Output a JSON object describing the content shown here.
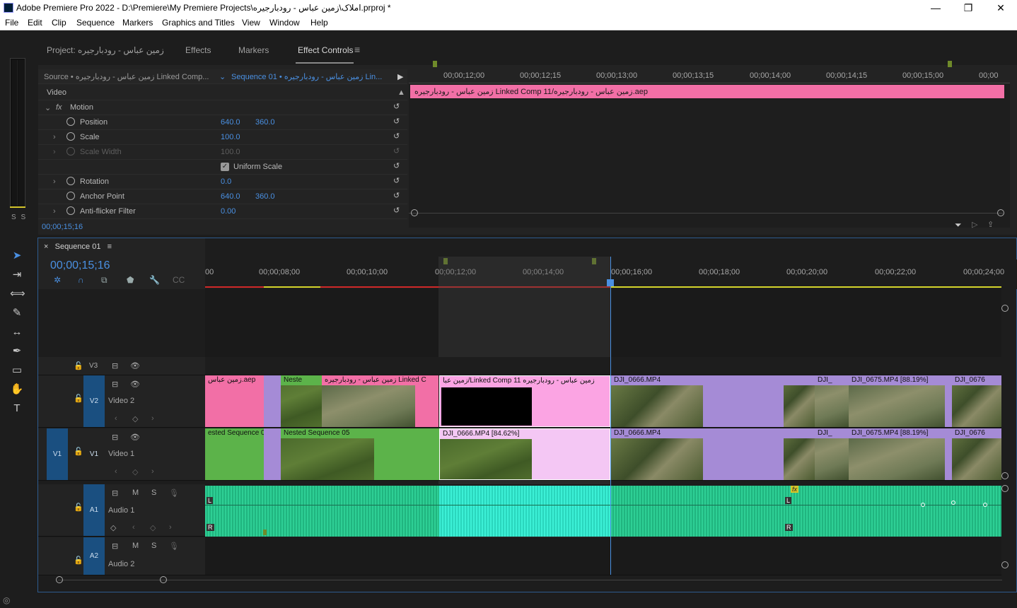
{
  "window": {
    "title": "Adobe Premiere Pro 2022 - D:\\Premiere\\My Premiere Projects\\املاک\\زمین عباس - رودبارجیره.prproj *",
    "min": "—",
    "max": "❐",
    "close": "✕"
  },
  "menu": [
    "File",
    "Edit",
    "Clip",
    "Sequence",
    "Markers",
    "Graphics and Titles",
    "View",
    "Window",
    "Help"
  ],
  "audio_meter": {
    "solo_labels": "S S"
  },
  "effect_controls": {
    "tabs": [
      "Project: زمین عباس - رودبارجیره",
      "Effects",
      "Markers",
      "Effect Controls"
    ],
    "menu_icon": "≡",
    "source_label": "Source • زمین عباس - رودبارجیره Linked Comp...",
    "sequence_label": "Sequence 01 • زمین عباس - رودبارجیره Lin...",
    "section_video": "Video",
    "fx_label": "fx",
    "motion": "Motion",
    "rows": [
      {
        "label": "Position",
        "v1": "640.0",
        "v2": "360.0"
      },
      {
        "label": "Scale",
        "v1": "100.0",
        "v2": ""
      },
      {
        "label": "Scale Width",
        "v1": "100.0",
        "v2": ""
      },
      {
        "label": "Uniform Scale",
        "v1": "",
        "v2": ""
      },
      {
        "label": "Rotation",
        "v1": "0.0",
        "v2": ""
      },
      {
        "label": "Anchor Point",
        "v1": "640.0",
        "v2": "360.0"
      },
      {
        "label": "Anti-flicker Filter",
        "v1": "0.00",
        "v2": ""
      }
    ],
    "ruler": [
      "00;00;12;00",
      "00;00;12;15",
      "00;00;13;00",
      "00;00;13;15",
      "00;00;14;00",
      "00;00;14;15",
      "00;00;15;00",
      "00;00"
    ],
    "clip_name": "زمین عباس - رودبارجیره Linked Comp 11/زمین عباس - رودبارجیره.aep",
    "timecode": "00;00;15;16"
  },
  "timeline": {
    "tab": "Sequence 01",
    "close": "×",
    "menu_icon": "≡",
    "timecode": "00;00;15;16",
    "ruler": [
      "00",
      "00;00;08;00",
      "00;00;10;00",
      "00;00;12;00",
      "00;00;14;00",
      "00;00;16;00",
      "00;00;18;00",
      "00;00;20;00",
      "00;00;22;00",
      "00;00;24;00"
    ],
    "tracks": {
      "v3": {
        "label": "V3"
      },
      "v2": {
        "label": "V2",
        "name": "Video 2"
      },
      "v1": {
        "label": "V1",
        "src": "V1",
        "name": "Video 1"
      },
      "a1": {
        "label": "A1",
        "name": "Audio 1",
        "m": "M",
        "s": "S"
      },
      "a2": {
        "label": "A2",
        "name": "Audio 2",
        "m": "M",
        "s": "S"
      }
    },
    "v2_clips": [
      {
        "name": "زمین عباس.aep"
      },
      {
        "name": ""
      },
      {
        "name": "Neste"
      },
      {
        "name": "زمین عباس - رودبارجیره Linked C"
      },
      {
        "name": "زمین عباس - رودبارجیره Linked Comp 11/زمین عبا"
      },
      {
        "name": "DJI_0666.MP4"
      },
      {
        "name": ""
      },
      {
        "name": ""
      },
      {
        "name": "DJI_"
      },
      {
        "name": "DJI_0675.MP4 [88.19%]"
      },
      {
        "name": ""
      },
      {
        "name": "DJI_0676"
      }
    ],
    "v1_clips": [
      {
        "name": "ested Sequence 04"
      },
      {
        "name": ""
      },
      {
        "name": "Nested Sequence 05"
      },
      {
        "name": "DJI_0666.MP4 [84.62%]"
      },
      {
        "name": "DJI_0666.MP4"
      },
      {
        "name": ""
      },
      {
        "name": ""
      },
      {
        "name": "DJI_"
      },
      {
        "name": "DJI_0675.MP4 [88.19%]"
      },
      {
        "name": ""
      },
      {
        "name": "DJI_0676"
      }
    ],
    "audio_channel_labels": {
      "L": "L",
      "R": "R",
      "fx": "fx"
    }
  },
  "colors": {
    "accent": "#4a90e2",
    "pink": "#f26fa6",
    "purple": "#a58bd6",
    "green": "#5cb34a",
    "audio": "#2ecf95"
  }
}
